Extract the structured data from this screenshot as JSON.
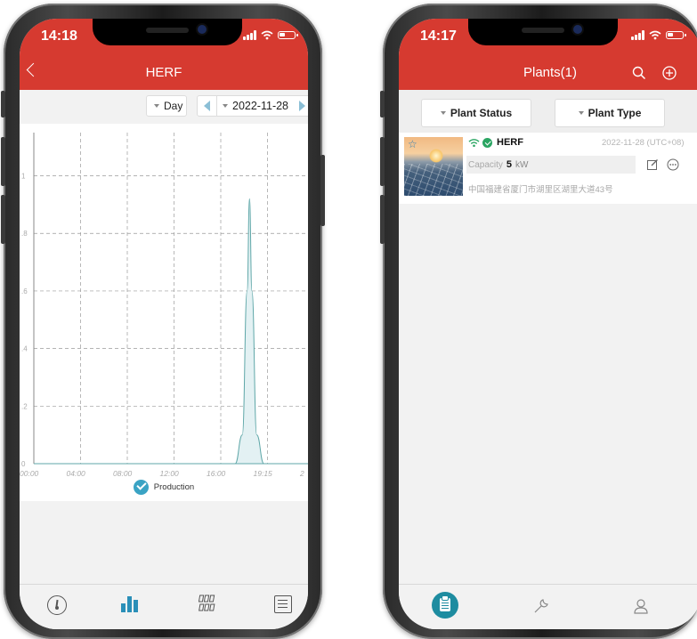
{
  "left_phone": {
    "status": {
      "time": "14:18"
    },
    "header": {
      "title": "HERF"
    },
    "toolbar": {
      "period_label": "Day",
      "date_value": "2022-11-28"
    },
    "chart_labels": {
      "y_ticks": [
        "1",
        ".8",
        ".6",
        ".4",
        ".2",
        "0"
      ],
      "x_ticks": [
        "00:00",
        "04:00",
        "08:00",
        "12:00",
        "16:00",
        "19:15",
        "2"
      ]
    },
    "legend": {
      "label": "Production"
    },
    "tabs": [
      {
        "icon": "gauge-icon",
        "active": false
      },
      {
        "icon": "bar-chart-icon",
        "active": true
      },
      {
        "icon": "device-grid-icon",
        "active": false
      },
      {
        "icon": "list-icon",
        "active": false
      }
    ]
  },
  "right_phone": {
    "status": {
      "time": "14:17"
    },
    "header": {
      "title": "Plants(1)"
    },
    "filters": {
      "status_label": "Plant Status",
      "type_label": "Plant Type"
    },
    "plant": {
      "name": "HERF",
      "date": "2022-11-28 (UTC+08)",
      "capacity_label": "Capacity",
      "capacity_value": "5",
      "capacity_unit": "kW",
      "address": "中国福建省厦门市湖里区湖里大道43号"
    },
    "tabs": [
      {
        "icon": "plants-list-icon",
        "active": true
      },
      {
        "icon": "wrench-icon",
        "active": false
      },
      {
        "icon": "user-icon",
        "active": false
      }
    ]
  },
  "colors": {
    "header_red": "#d63a30",
    "accent_teal": "#3aa3c4",
    "curve_fill": "#e3f1f3",
    "curve_stroke": "#5fa7a8",
    "online_green": "#2aa562"
  },
  "chart_data": {
    "type": "area",
    "title": "",
    "xlabel": "",
    "ylabel": "",
    "x_ticks": [
      "00:00",
      "04:00",
      "08:00",
      "12:00",
      "16:00",
      "19:15"
    ],
    "ylim": [
      0,
      1.15
    ],
    "series": [
      {
        "name": "Production",
        "x": [
          "16:40",
          "17:00",
          "17:30",
          "17:50",
          "18:00",
          "18:10",
          "18:30",
          "19:00",
          "19:10"
        ],
        "values": [
          0,
          0,
          0.1,
          0.6,
          0.92,
          0.6,
          0.1,
          0,
          0
        ]
      }
    ],
    "grid": true,
    "legend_position": "bottom"
  }
}
